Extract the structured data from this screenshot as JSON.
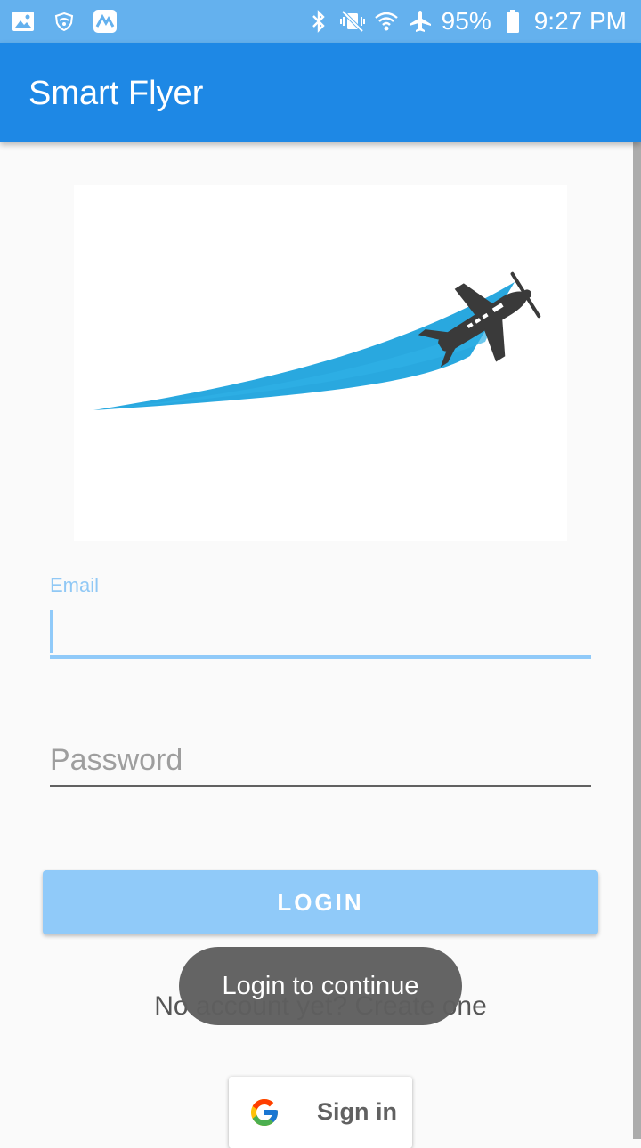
{
  "status_bar": {
    "battery": "95%",
    "time": "9:27 PM",
    "icons": [
      "gallery-icon",
      "wifi-shield-icon",
      "app-icon",
      "bluetooth-icon",
      "mute-vibrate-icon",
      "wifi-icon",
      "airplane-mode-icon",
      "battery-icon"
    ]
  },
  "app_bar": {
    "title": "Smart Flyer"
  },
  "logo": {
    "name": "airplane-logo",
    "colors": {
      "swoosh": "#29a8df",
      "plane": "#3a3a3a"
    }
  },
  "form": {
    "email_label": "Email",
    "email_value": "",
    "password_placeholder": "Password",
    "password_value": ""
  },
  "login_button": "LOGIN",
  "create_account": "No account yet? Create one",
  "toast": "Login to continue",
  "google_button": "Sign in",
  "colors": {
    "status_bar": "#64b1ee",
    "app_bar": "#1e88e5",
    "accent_light": "#90caf9",
    "background": "#fafafa"
  }
}
